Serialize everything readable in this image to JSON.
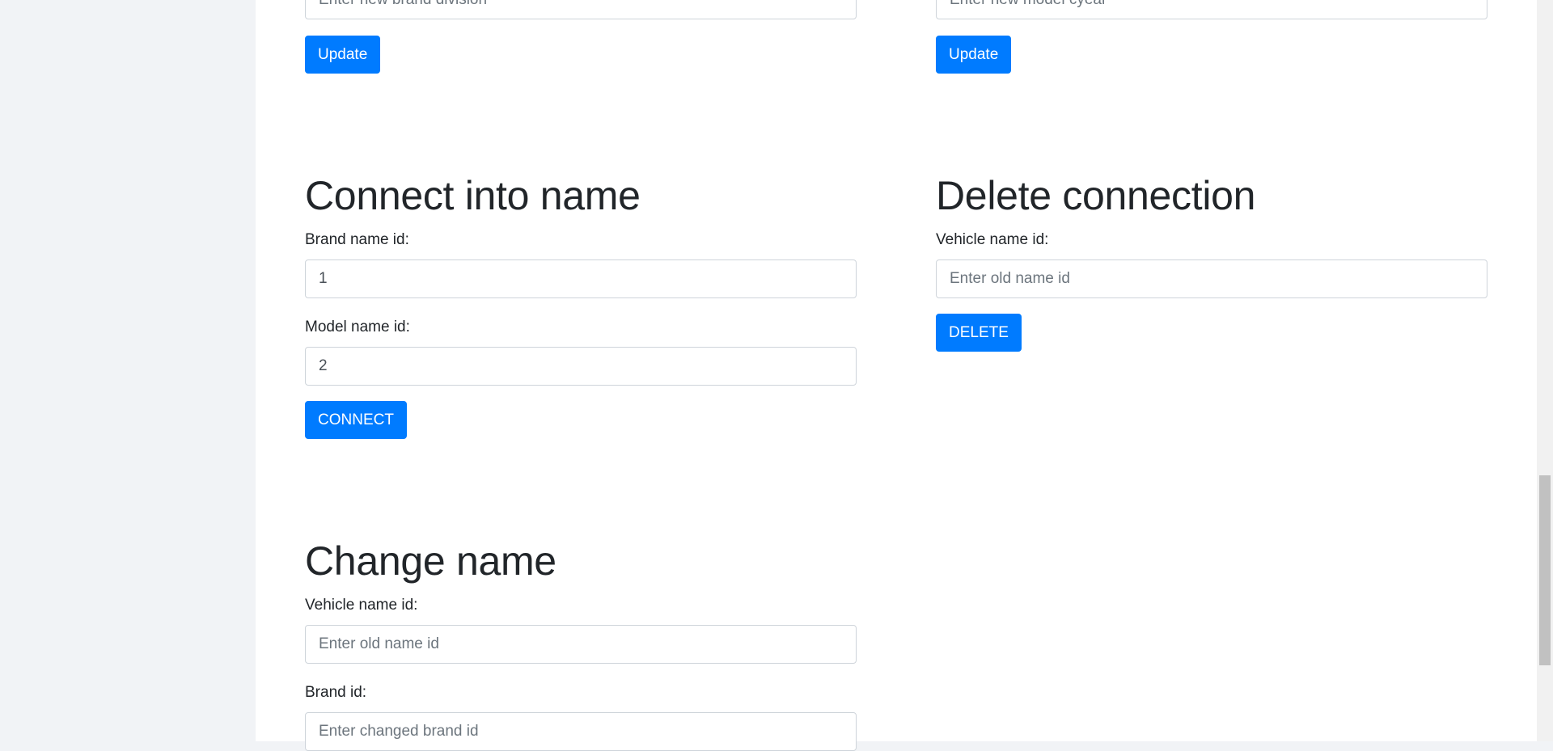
{
  "top_left": {
    "input_placeholder": "Enter new brand division",
    "button_label": "Update"
  },
  "top_right": {
    "input_placeholder": "Enter new model cyear",
    "button_label": "Update"
  },
  "connect": {
    "title": "Connect into name",
    "brand_label": "Brand name id:",
    "brand_value": "1",
    "model_label": "Model name id:",
    "model_value": "2",
    "button_label": "CONNECT"
  },
  "delete": {
    "title": "Delete connection",
    "vehicle_label": "Vehicle name id:",
    "vehicle_placeholder": "Enter old name id",
    "button_label": "DELETE"
  },
  "change": {
    "title": "Change name",
    "vehicle_label": "Vehicle name id:",
    "vehicle_placeholder": "Enter old name id",
    "brand_label": "Brand id:",
    "brand_placeholder": "Enter changed brand id"
  },
  "colors": {
    "primary": "#007bff",
    "sidebar_bg": "#f1f3f6",
    "text": "#212529"
  }
}
